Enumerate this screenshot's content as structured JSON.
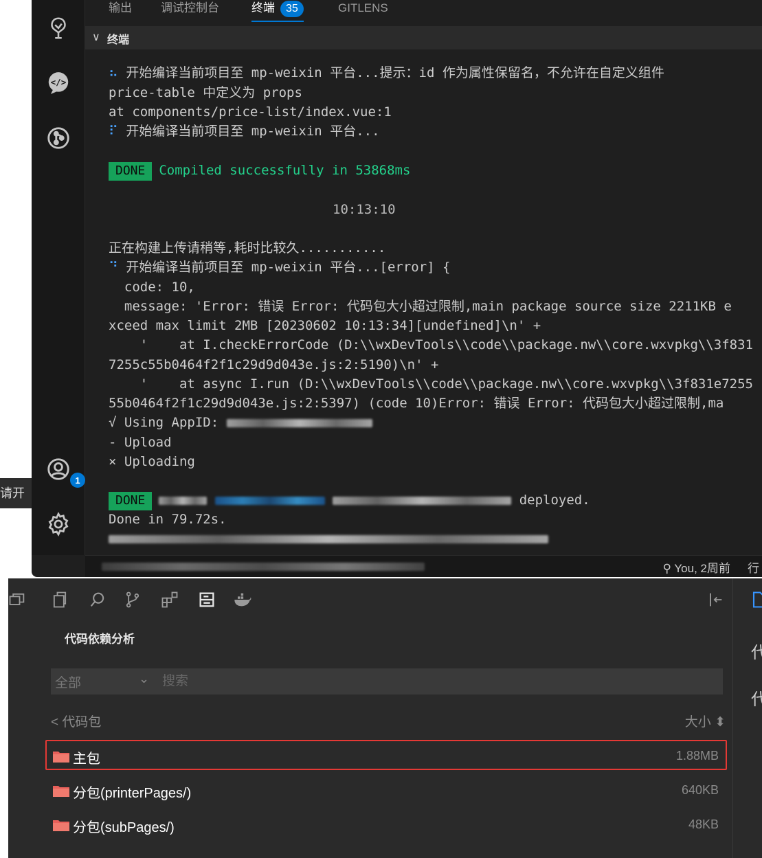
{
  "panel": {
    "tabs": [
      {
        "label": "输出"
      },
      {
        "label": "调试控制台"
      },
      {
        "label": "终端",
        "count": "35"
      },
      {
        "label": "GITLENS"
      }
    ],
    "terminal_section_title": "终端"
  },
  "activity_bar": {
    "icons": [
      "source-tree-icon",
      "chat-code-icon",
      "git-graph-icon",
      "account-icon",
      "settings-gear-icon"
    ],
    "account_badge": "1"
  },
  "terminal": {
    "lines": [
      {
        "prefix": "⠦",
        "text": " 开始编译当前项目至 mp-weixin 平台...提示：id 作为属性保留名，不允许在自定义组件"
      },
      {
        "text": "price-table 中定义为 props"
      },
      {
        "text": "at components/price-list/index.vue:1"
      },
      {
        "prefix": "⠏",
        "text": " 开始编译当前项目至 mp-weixin 平台..."
      },
      {
        "done": "DONE",
        "text": "Compiled successfully in 53868ms"
      },
      {
        "text": "10:13:10"
      },
      {
        "text": "正在构建上传请稍等,耗时比较久..........."
      },
      {
        "prefix": "⠙",
        "text": " 开始编译当前项目至 mp-weixin 平台...[error] {"
      },
      {
        "text": "  code: 10,"
      },
      {
        "text": "  message: 'Error: 错误 Error: 代码包大小超过限制,main package source size 2211KB e"
      },
      {
        "text": "xceed max limit 2MB [20230602 10:13:34][undefined]\\n' +"
      },
      {
        "text": "    '    at I.checkErrorCode (D:\\\\wxDevTools\\\\code\\\\package.nw\\\\core.wxvpkg\\\\3f831"
      },
      {
        "text": "7255c55b0464f2f1c29d9d043e.js:2:5190)\\n' +"
      },
      {
        "text": "    '    at async I.run (D:\\\\wxDevTools\\\\code\\\\package.nw\\\\core.wxvpkg\\\\3f831e7255"
      },
      {
        "text": "55b0464f2f1c29d9d043e.js:2:5397) (code 10)Error: 错误 Error: 代码包大小超过限制,ma"
      },
      {
        "text": "√ Using AppID: "
      },
      {
        "text": "- Upload"
      },
      {
        "text": "× Uploading"
      },
      {
        "done": "DONE",
        "text": "deployed."
      },
      {
        "text": "Done in 79.72s."
      }
    ]
  },
  "status_bar": {
    "git_blame": "You, 2周前",
    "line_fragment": "行"
  },
  "left_fragment": "请开",
  "devtools": {
    "section_title": "代码依赖分析",
    "filter": {
      "selected": "全部",
      "search_placeholder": "搜索"
    },
    "table_header": {
      "back_label": "< 代码包",
      "size_label": "大小 ⬍"
    },
    "packages": [
      {
        "name": "主包",
        "size": "1.88MB",
        "highlighted": true
      },
      {
        "name": "分包(printerPages/)",
        "size": "640KB"
      },
      {
        "name": "分包(subPages/)",
        "size": "48KB"
      }
    ],
    "right_fragments": [
      "代",
      "代"
    ]
  },
  "colors": {
    "highlight": "#e53935",
    "done_badge": "#16a25a",
    "accent": "#0078d4",
    "folder": "#e8605a"
  }
}
